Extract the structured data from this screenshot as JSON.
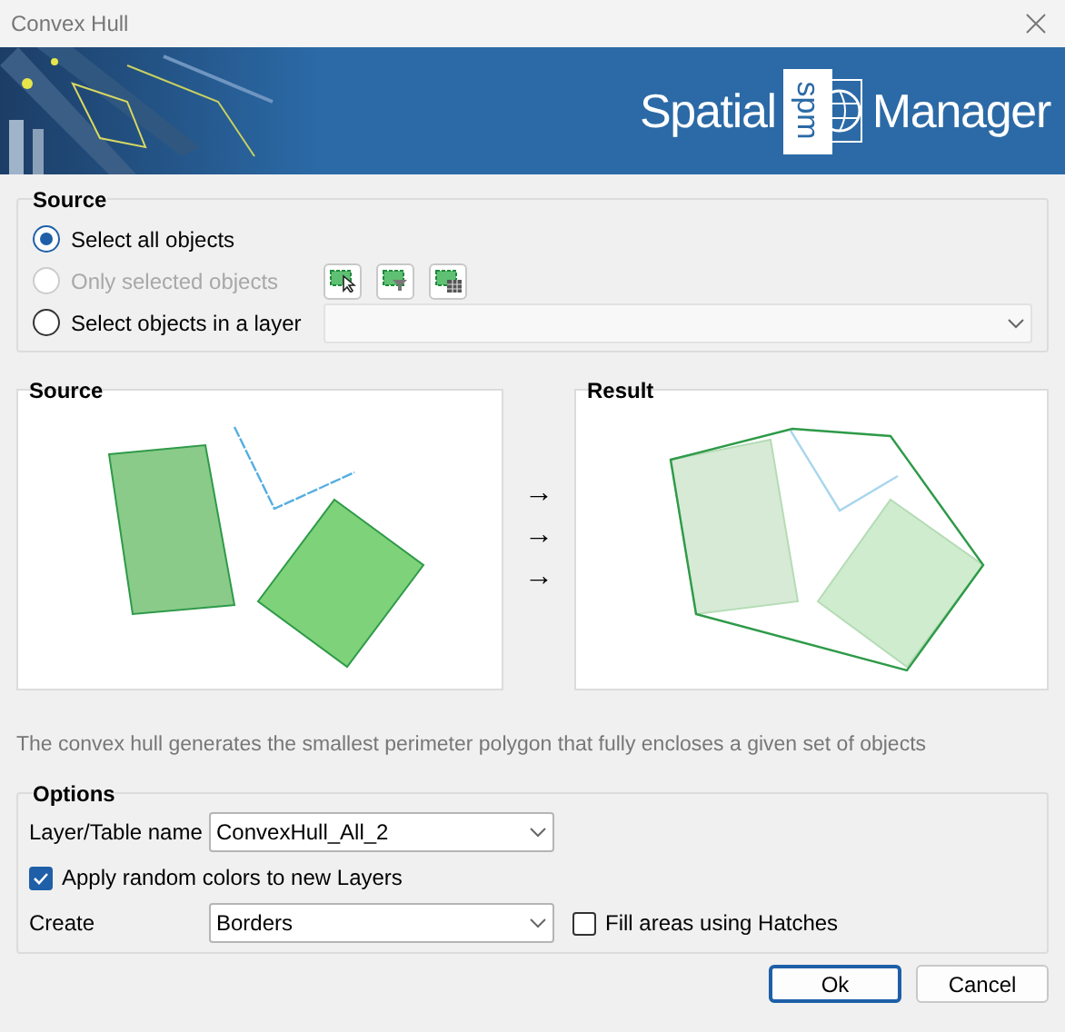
{
  "window": {
    "title": "Convex Hull"
  },
  "banner": {
    "logo_left": "Spatial",
    "logo_mark": "spm",
    "logo_right": "Manager"
  },
  "source": {
    "title": "Source",
    "options": [
      {
        "label": "Select all objects",
        "selected": true,
        "disabled": false
      },
      {
        "label": "Only selected objects",
        "selected": false,
        "disabled": true
      },
      {
        "label": "Select objects in a layer",
        "selected": false,
        "disabled": false
      }
    ]
  },
  "preview": {
    "source_title": "Source",
    "result_title": "Result",
    "arrows": [
      "→",
      "→",
      "→"
    ]
  },
  "description": "The convex hull generates the smallest perimeter polygon that fully encloses a given set of objects",
  "options": {
    "title": "Options",
    "layer_label": "Layer/Table name",
    "layer_value": "ConvexHull_All_2",
    "random_colors": {
      "label": "Apply random colors to new Layers",
      "checked": true
    },
    "create_label": "Create",
    "create_value": "Borders",
    "hatches": {
      "label": "Fill areas using Hatches",
      "checked": false
    }
  },
  "buttons": [
    {
      "label": "Ok",
      "default": true
    },
    {
      "label": "Cancel",
      "default": false
    }
  ]
}
